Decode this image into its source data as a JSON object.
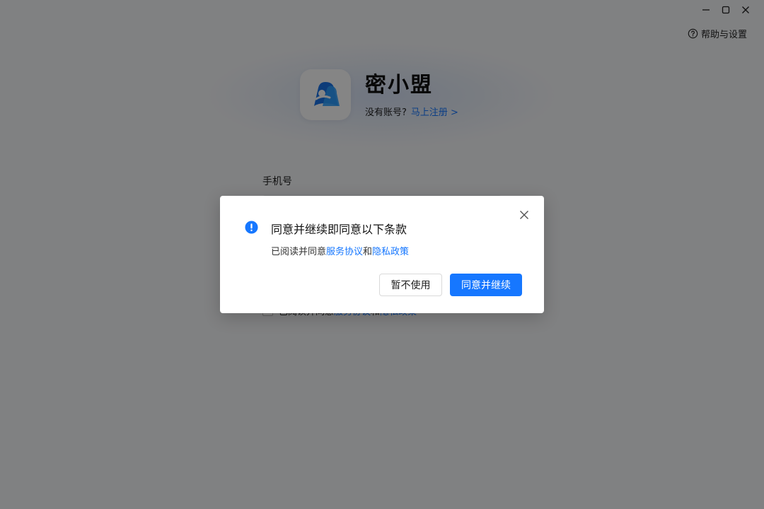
{
  "window": {
    "help_label": "帮助与设置"
  },
  "brand": {
    "name": "密小盟",
    "no_account": "没有账号?",
    "register_link": "马上注册 >"
  },
  "login_form": {
    "phone_label": "手机号",
    "phone_value": "",
    "agree_prefix": "已阅读并同意",
    "agree_service": "服务协议",
    "agree_and": "和",
    "agree_privacy": "隐私政策"
  },
  "dialog": {
    "title": "同意并继续即同意以下条款",
    "body_prefix": "已阅读并同意",
    "service_link": "服务协议",
    "and_text": "和",
    "privacy_link": "隐私政策",
    "cancel_label": "暂不使用",
    "confirm_label": "同意并继续"
  },
  "colors": {
    "accent": "#1677ff",
    "overlay": "rgba(0,0,0,0.48)",
    "window_bg": "#f6f7f9"
  }
}
